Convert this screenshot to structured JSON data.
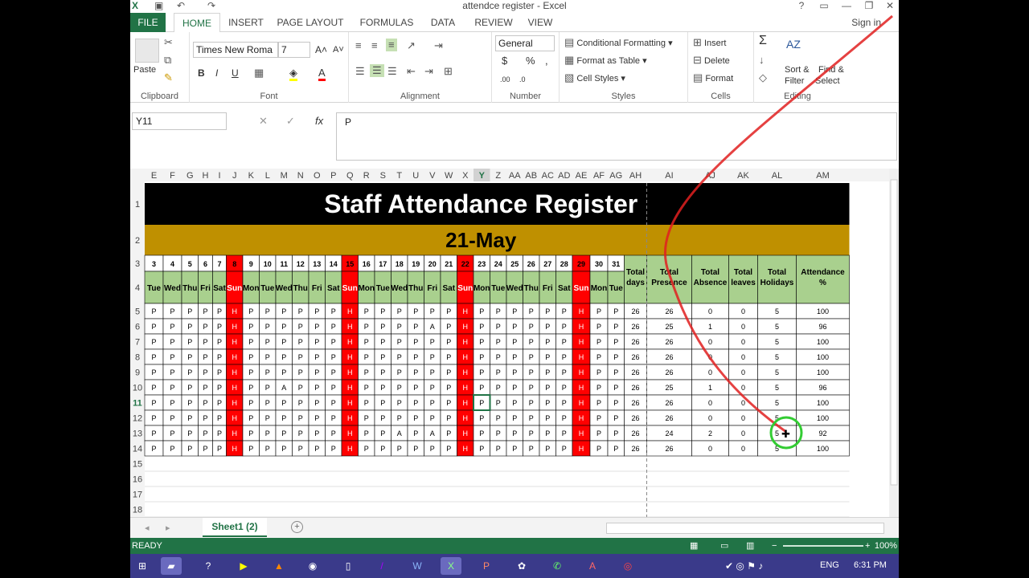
{
  "window": {
    "title": "attendce register - Excel",
    "help": "?",
    "min": "—",
    "restore": "❐",
    "close": "✕"
  },
  "tabs": [
    "FILE",
    "HOME",
    "INSERT",
    "PAGE LAYOUT",
    "FORMULAS",
    "DATA",
    "REVIEW",
    "VIEW"
  ],
  "active_tab": "HOME",
  "signin": "Sign in",
  "ribbon": {
    "clipboard": {
      "label": "Clipboard",
      "paste": "Paste"
    },
    "font": {
      "label": "Font",
      "name": "Times New Roma",
      "size": "7",
      "bold": "B",
      "italic": "I",
      "underline": "U"
    },
    "alignment": {
      "label": "Alignment"
    },
    "number": {
      "label": "Number",
      "format": "General",
      "currency": "$",
      "percent": "%",
      "comma": ","
    },
    "styles": {
      "label": "Styles",
      "cond": "Conditional Formatting",
      "table": "Format as Table",
      "cell": "Cell Styles"
    },
    "cells": {
      "label": "Cells",
      "insert": "Insert",
      "delete": "Delete",
      "format": "Format"
    },
    "editing": {
      "label": "Editing",
      "sum": "Σ",
      "sort": "Sort &",
      "sort2": "Filter",
      "find": "Find &",
      "find2": "Select"
    }
  },
  "formula_bar": {
    "name_box": "Y11",
    "cancel": "✕",
    "enter": "✓",
    "fx": "fx",
    "value": "P"
  },
  "columns": [
    "E",
    "F",
    "G",
    "H",
    "I",
    "J",
    "K",
    "L",
    "M",
    "N",
    "O",
    "P",
    "Q",
    "R",
    "S",
    "T",
    "U",
    "V",
    "W",
    "X",
    "Y",
    "Z",
    "AA",
    "AB",
    "AC",
    "AD",
    "AE",
    "AF",
    "AG",
    "AH",
    "AI",
    "AJ",
    "AK",
    "AL",
    "AM"
  ],
  "selected_column": "Y",
  "row_numbers": [
    "1",
    "2",
    "3",
    "4",
    "5",
    "6",
    "7",
    "8",
    "9",
    "10",
    "11",
    "12",
    "13",
    "14",
    "15",
    "16",
    "17",
    "18"
  ],
  "sheet": {
    "title": "Staff Attendance Register",
    "month": "21-May",
    "dates": [
      "3",
      "4",
      "5",
      "6",
      "7",
      "8",
      "9",
      "10",
      "11",
      "12",
      "13",
      "14",
      "15",
      "16",
      "17",
      "18",
      "19",
      "20",
      "21",
      "22",
      "23",
      "24",
      "25",
      "26",
      "27",
      "28",
      "29",
      "30",
      "31"
    ],
    "days": [
      "Tue",
      "Wed",
      "Thu",
      "Fri",
      "Sat",
      "Sun",
      "Mon",
      "Tue",
      "Wed",
      "Thu",
      "Fri",
      "Sat",
      "Sun",
      "Mon",
      "Tue",
      "Wed",
      "Thu",
      "Fri",
      "Sat",
      "Sun",
      "Mon",
      "Tue",
      "Wed",
      "Thu",
      "Fri",
      "Sat",
      "Sun",
      "Mon",
      "Tue"
    ],
    "holiday_cols": [
      5,
      12,
      19,
      26
    ],
    "summary_headers": [
      "Total days",
      "Total Presence",
      "Total Absence",
      "Total leaves",
      "Total Holidays",
      "Attendance %"
    ],
    "rows": [
      {
        "marks": "PPPPPHPPPPPPHPPPPPPHPPPPPPHPP",
        "total": "26",
        "presence": "26",
        "absence": "0",
        "leaves": "0",
        "holidays": "5",
        "pct": "100"
      },
      {
        "marks": "PPPPPHPPPPPPHPPPPAPHPPPPPPHPP",
        "total": "26",
        "presence": "25",
        "absence": "1",
        "leaves": "0",
        "holidays": "5",
        "pct": "96"
      },
      {
        "marks": "PPPPPHPPPPPPHPPPPPPHPPPPPPHPP",
        "total": "26",
        "presence": "26",
        "absence": "0",
        "leaves": "0",
        "holidays": "5",
        "pct": "100"
      },
      {
        "marks": "PPPPPHPPPPPPHPPPPPPHPPPPPPHPP",
        "total": "26",
        "presence": "26",
        "absence": "0",
        "leaves": "0",
        "holidays": "5",
        "pct": "100"
      },
      {
        "marks": "PPPPPHPPPPPPHPPPPPPHPPPPPPHPP",
        "total": "26",
        "presence": "26",
        "absence": "0",
        "leaves": "0",
        "holidays": "5",
        "pct": "100"
      },
      {
        "marks": "PPPPPHPPAPPPHPPPPPPHPPPPPPHPP",
        "total": "26",
        "presence": "25",
        "absence": "1",
        "leaves": "0",
        "holidays": "5",
        "pct": "96"
      },
      {
        "marks": "PPPPPHPPPPPPHPPPPPPHPPPPPPHPP",
        "total": "26",
        "presence": "26",
        "absence": "0",
        "leaves": "0",
        "holidays": "5",
        "pct": "100"
      },
      {
        "marks": "PPPPPHPPPPPPHPPPPPPHPPPPPPHPP",
        "total": "26",
        "presence": "26",
        "absence": "0",
        "leaves": "0",
        "holidays": "5",
        "pct": "100"
      },
      {
        "marks": "PPPPPHPPPPPPHPPAPAPHPPPPPPHPP",
        "total": "26",
        "presence": "24",
        "absence": "2",
        "leaves": "0",
        "holidays": "5",
        "pct": "92"
      },
      {
        "marks": "PPPPPHPPPPPPHPPPPPPHPPPPPPHPP",
        "total": "26",
        "presence": "26",
        "absence": "0",
        "leaves": "0",
        "holidays": "5",
        "pct": "100"
      }
    ]
  },
  "sheet_tab": "Sheet1 (2)",
  "status": {
    "ready": "READY",
    "zoom": "100%"
  },
  "taskbar": {
    "lang": "ENG",
    "time": "6:31 PM"
  },
  "colors": {
    "excel_green": "#217346",
    "title_bg": "#000000",
    "month_bg": "#bf9000",
    "header_green": "#a9d08e",
    "holiday_red": "#ff0000",
    "annotation_red": "#e02020",
    "circle_green": "#33cc33"
  }
}
